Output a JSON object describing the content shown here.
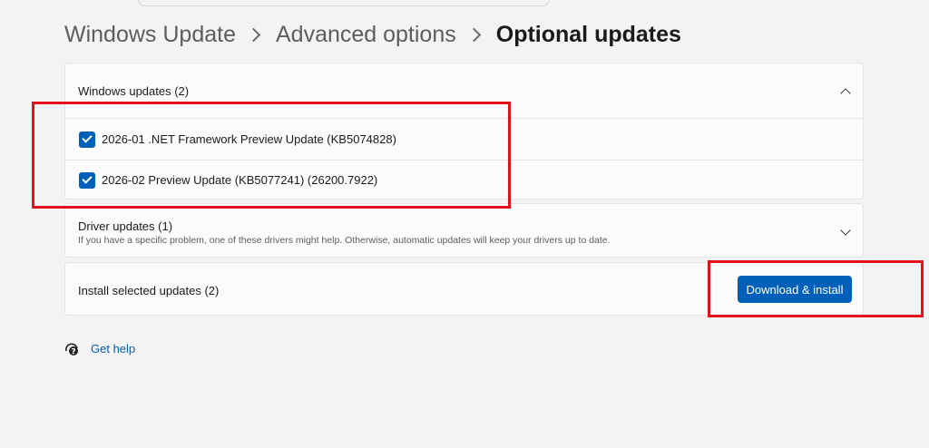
{
  "breadcrumb": {
    "items": [
      "Windows Update",
      "Advanced options"
    ],
    "current": "Optional updates"
  },
  "windows_updates": {
    "title": "Windows updates (2)",
    "items": [
      {
        "label": "2026-01 .NET Framework Preview Update (KB5074828)",
        "checked": true
      },
      {
        "label": "2026-02 Preview Update (KB5077241) (26200.7922)",
        "checked": true
      }
    ],
    "expanded": true
  },
  "driver_updates": {
    "title": "Driver updates (1)",
    "description": "If you have a specific problem, one of these drivers might help. Otherwise, automatic updates will keep your drivers up to date.",
    "expanded": false
  },
  "install": {
    "label": "Install selected updates (2)",
    "button_label": "Download & install"
  },
  "help": {
    "link_label": "Get help"
  },
  "colors": {
    "accent": "#005fb8",
    "annotation": "#e1131a",
    "background": "#f3f3f3"
  },
  "icons": [
    "chevron-right-icon",
    "chevron-up-icon",
    "chevron-down-icon",
    "checkmark-icon",
    "help-icon"
  ]
}
